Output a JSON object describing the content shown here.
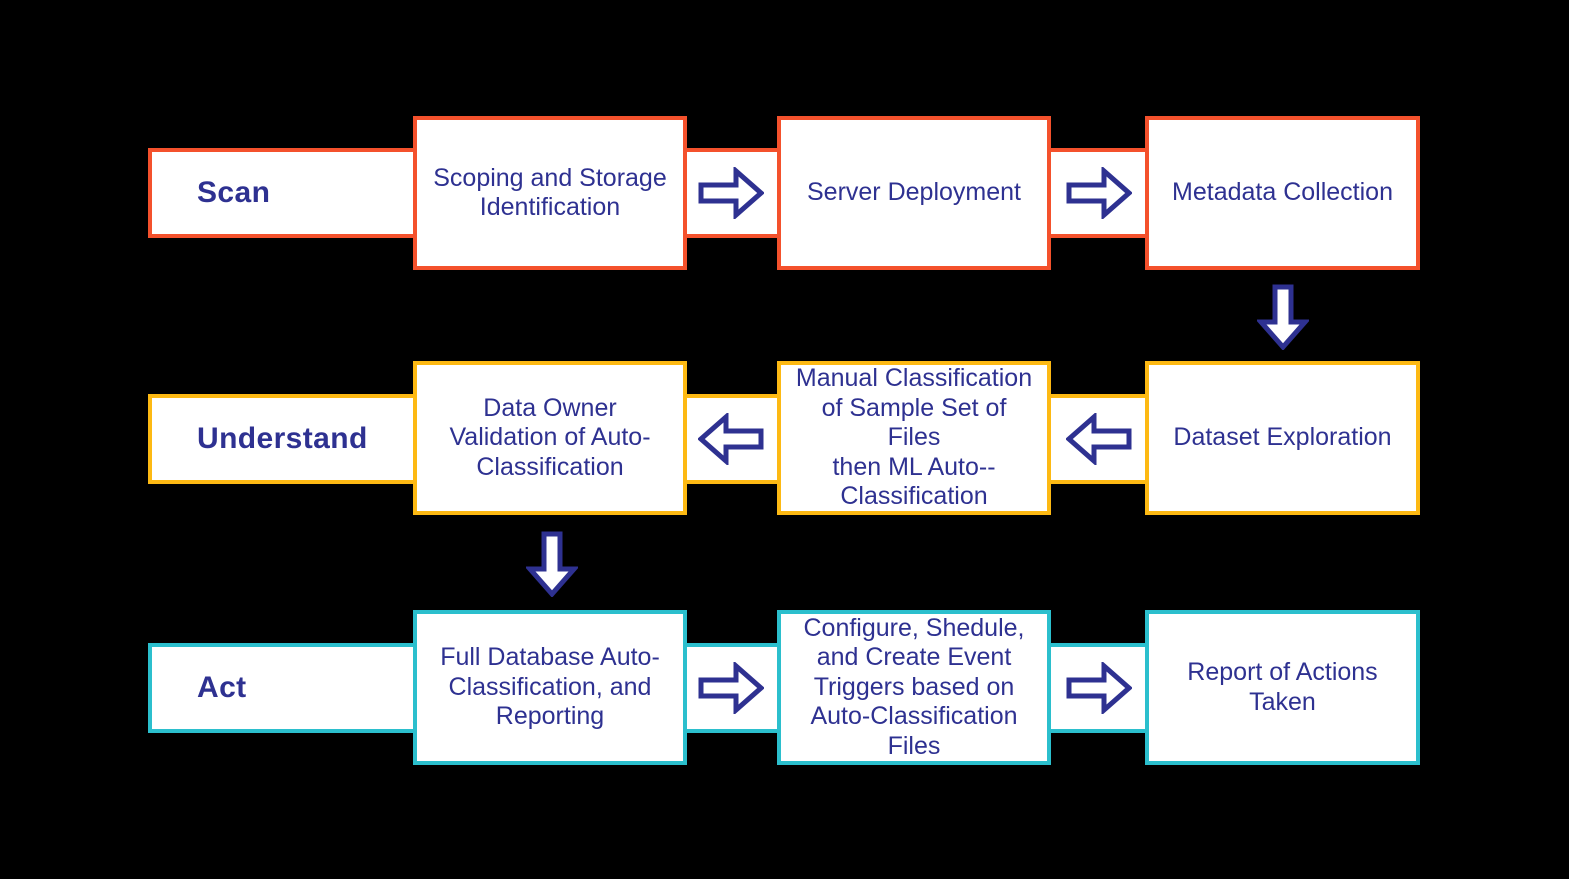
{
  "diagram": {
    "title": "Scan / Understand / Act data classification process",
    "background_color": "#000000",
    "text_color": "#2e3191",
    "box_fill": "#ffffff"
  },
  "rows": [
    {
      "id": "scan",
      "stage_label": "Scan",
      "accent_color": "#f4512c",
      "flow_direction": "left-to-right",
      "boxes": [
        {
          "label": "Scoping and Storage\nIdentification"
        },
        {
          "label": "Server Deployment"
        },
        {
          "label": "Metadata Collection"
        }
      ],
      "connectors": [
        {
          "icon": "arrow-right-icon"
        },
        {
          "icon": "arrow-right-icon"
        }
      ]
    },
    {
      "id": "understand",
      "stage_label": "Understand",
      "accent_color": "#fdb913",
      "flow_direction": "right-to-left",
      "boxes": [
        {
          "label": "Data Owner\nValidation of Auto-\nClassification"
        },
        {
          "label": "Manual Classification\nof Sample Set of Files\nthen ML Auto--\nClassification"
        },
        {
          "label": "Dataset Exploration"
        }
      ],
      "connectors": [
        {
          "icon": "arrow-left-icon"
        },
        {
          "icon": "arrow-left-icon"
        }
      ]
    },
    {
      "id": "act",
      "stage_label": "Act",
      "accent_color": "#2bbfcd",
      "flow_direction": "left-to-right",
      "boxes": [
        {
          "label": "Full Database Auto-\nClassification, and\nReporting"
        },
        {
          "label": "Configure, Shedule,\nand Create Event\nTriggers based on\nAuto-Classification\nFiles"
        },
        {
          "label": "Report of Actions\nTaken"
        }
      ],
      "connectors": [
        {
          "icon": "arrow-right-icon"
        },
        {
          "icon": "arrow-right-icon"
        }
      ]
    }
  ],
  "vertical_connectors": [
    {
      "id": "scan-to-understand",
      "icon": "arrow-down-icon",
      "from": "Metadata Collection",
      "to": "Dataset Exploration"
    },
    {
      "id": "understand-to-act",
      "icon": "arrow-down-icon",
      "from": "Data Owner Validation of Auto-Classification",
      "to": "Full Database Auto-Classification, and Reporting"
    }
  ]
}
